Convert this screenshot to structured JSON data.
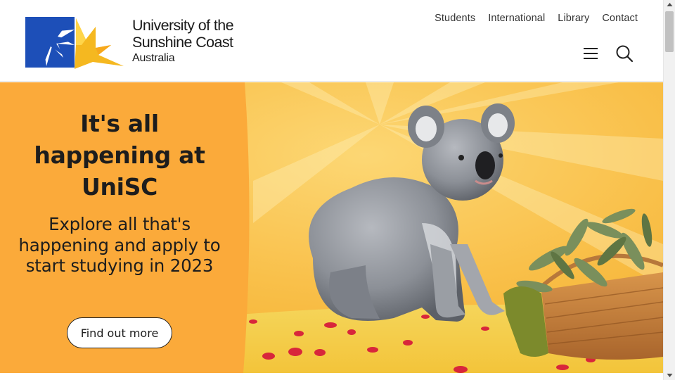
{
  "header": {
    "logo": {
      "line1": "University of the",
      "line2": "Sunshine Coast",
      "line3": "Australia",
      "colors": {
        "blue": "#1d4fb8",
        "yellow": "#f5b820"
      }
    },
    "util_nav": [
      {
        "label": "Students"
      },
      {
        "label": "International"
      },
      {
        "label": "Library"
      },
      {
        "label": "Contact"
      }
    ],
    "icons": {
      "menu": "hamburger-menu-icon",
      "search": "search-icon"
    }
  },
  "hero": {
    "title": "It's all happening at UniSC",
    "subtitle": "Explore all that's happening and apply to start studying in 2023",
    "button_label": "Find out more",
    "colors": {
      "panel": "#fbaa3a",
      "accent": "#f9b53f"
    },
    "image": "koala-with-basket-photo"
  }
}
